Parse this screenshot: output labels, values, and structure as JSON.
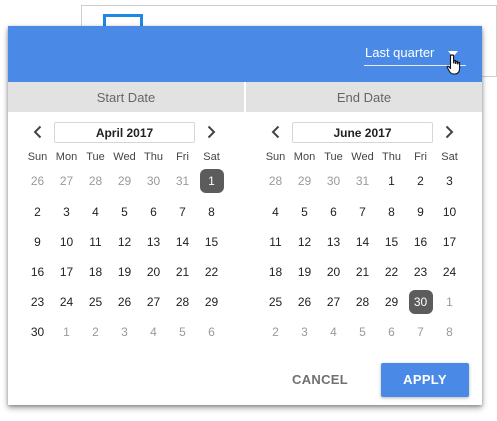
{
  "header": {
    "range_label": "Last quarter"
  },
  "columns": {
    "start_label": "Start Date",
    "end_label": "End Date"
  },
  "weekdays": [
    "Sun",
    "Mon",
    "Tue",
    "Wed",
    "Thu",
    "Fri",
    "Sat"
  ],
  "start_calendar": {
    "month_label": "April 2017",
    "weeks": [
      [
        {
          "d": "26",
          "m": true
        },
        {
          "d": "27",
          "m": true
        },
        {
          "d": "28",
          "m": true
        },
        {
          "d": "29",
          "m": true
        },
        {
          "d": "30",
          "m": true
        },
        {
          "d": "31",
          "m": true
        },
        {
          "d": "1",
          "s": true
        }
      ],
      [
        {
          "d": "2"
        },
        {
          "d": "3"
        },
        {
          "d": "4"
        },
        {
          "d": "5"
        },
        {
          "d": "6"
        },
        {
          "d": "7"
        },
        {
          "d": "8"
        }
      ],
      [
        {
          "d": "9"
        },
        {
          "d": "10"
        },
        {
          "d": "11"
        },
        {
          "d": "12"
        },
        {
          "d": "13"
        },
        {
          "d": "14"
        },
        {
          "d": "15"
        }
      ],
      [
        {
          "d": "16"
        },
        {
          "d": "17"
        },
        {
          "d": "18"
        },
        {
          "d": "19"
        },
        {
          "d": "20"
        },
        {
          "d": "21"
        },
        {
          "d": "22"
        }
      ],
      [
        {
          "d": "23"
        },
        {
          "d": "24"
        },
        {
          "d": "25"
        },
        {
          "d": "26"
        },
        {
          "d": "27"
        },
        {
          "d": "28"
        },
        {
          "d": "29"
        }
      ],
      [
        {
          "d": "30"
        },
        {
          "d": "1",
          "m": true
        },
        {
          "d": "2",
          "m": true
        },
        {
          "d": "3",
          "m": true
        },
        {
          "d": "4",
          "m": true
        },
        {
          "d": "5",
          "m": true
        },
        {
          "d": "6",
          "m": true
        }
      ]
    ]
  },
  "end_calendar": {
    "month_label": "June 2017",
    "weeks": [
      [
        {
          "d": "28",
          "m": true
        },
        {
          "d": "29",
          "m": true
        },
        {
          "d": "30",
          "m": true
        },
        {
          "d": "31",
          "m": true
        },
        {
          "d": "1"
        },
        {
          "d": "2"
        },
        {
          "d": "3"
        }
      ],
      [
        {
          "d": "4"
        },
        {
          "d": "5"
        },
        {
          "d": "6"
        },
        {
          "d": "7"
        },
        {
          "d": "8"
        },
        {
          "d": "9"
        },
        {
          "d": "10"
        }
      ],
      [
        {
          "d": "11"
        },
        {
          "d": "12"
        },
        {
          "d": "13"
        },
        {
          "d": "14"
        },
        {
          "d": "15"
        },
        {
          "d": "16"
        },
        {
          "d": "17"
        }
      ],
      [
        {
          "d": "18"
        },
        {
          "d": "19"
        },
        {
          "d": "20"
        },
        {
          "d": "21"
        },
        {
          "d": "22"
        },
        {
          "d": "23"
        },
        {
          "d": "24"
        }
      ],
      [
        {
          "d": "25"
        },
        {
          "d": "26"
        },
        {
          "d": "27"
        },
        {
          "d": "28"
        },
        {
          "d": "29"
        },
        {
          "d": "30",
          "s": true
        },
        {
          "d": "1",
          "m": true
        }
      ],
      [
        {
          "d": "2",
          "m": true
        },
        {
          "d": "3",
          "m": true
        },
        {
          "d": "4",
          "m": true
        },
        {
          "d": "5",
          "m": true
        },
        {
          "d": "6",
          "m": true
        },
        {
          "d": "7",
          "m": true
        },
        {
          "d": "8",
          "m": true
        }
      ]
    ]
  },
  "footer": {
    "cancel_label": "CANCEL",
    "apply_label": "APPLY"
  },
  "colors": {
    "accent": "#4a8ae6",
    "selected_day": "#5c5c5c",
    "column_header_bg": "#e2e2e2"
  },
  "icons": {
    "prev": "chevron-left-icon",
    "next": "chevron-right-icon",
    "dropdown": "caret-down-icon",
    "cursor": "hand-pointer-icon"
  }
}
